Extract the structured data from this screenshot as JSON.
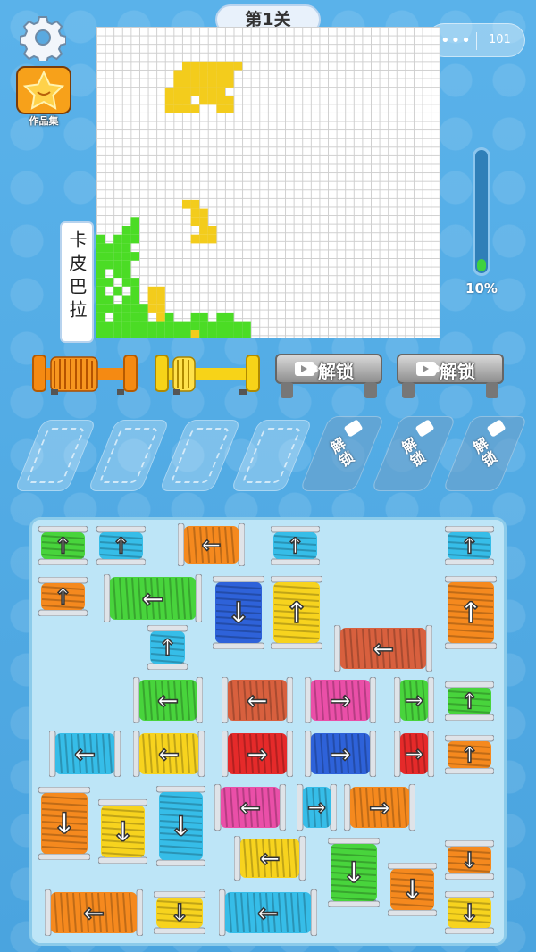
{
  "header": {
    "level_title": "第1关"
  },
  "works": {
    "label": "作品集"
  },
  "capsule": {
    "dots": "•••",
    "counter": "101"
  },
  "puzzle": {
    "name": "卡皮巴拉",
    "cols": 40,
    "rows": 36,
    "yellow_cells": [
      [
        10,
        4
      ],
      [
        11,
        4
      ],
      [
        12,
        4
      ],
      [
        13,
        4
      ],
      [
        14,
        4
      ],
      [
        15,
        4
      ],
      [
        16,
        4
      ],
      [
        9,
        5
      ],
      [
        10,
        5
      ],
      [
        11,
        5
      ],
      [
        12,
        5
      ],
      [
        13,
        5
      ],
      [
        14,
        5
      ],
      [
        15,
        5
      ],
      [
        9,
        6
      ],
      [
        10,
        6
      ],
      [
        11,
        6
      ],
      [
        12,
        6
      ],
      [
        13,
        6
      ],
      [
        14,
        6
      ],
      [
        15,
        6
      ],
      [
        8,
        7
      ],
      [
        9,
        7
      ],
      [
        10,
        7
      ],
      [
        11,
        7
      ],
      [
        12,
        7
      ],
      [
        13,
        7
      ],
      [
        14,
        7
      ],
      [
        8,
        8
      ],
      [
        9,
        8
      ],
      [
        10,
        8
      ],
      [
        12,
        8
      ],
      [
        13,
        8
      ],
      [
        14,
        8
      ],
      [
        15,
        8
      ],
      [
        8,
        9
      ],
      [
        9,
        9
      ],
      [
        10,
        9
      ],
      [
        11,
        9
      ],
      [
        14,
        9
      ],
      [
        15,
        9
      ],
      [
        10,
        20
      ],
      [
        11,
        20
      ],
      [
        11,
        21
      ],
      [
        12,
        21
      ],
      [
        11,
        22
      ],
      [
        12,
        22
      ],
      [
        12,
        23
      ],
      [
        13,
        23
      ],
      [
        11,
        24
      ],
      [
        12,
        24
      ],
      [
        13,
        24
      ],
      [
        6,
        30
      ],
      [
        7,
        30
      ],
      [
        6,
        31
      ],
      [
        7,
        31
      ],
      [
        6,
        32
      ],
      [
        7,
        32
      ],
      [
        7,
        33
      ],
      [
        11,
        35
      ]
    ],
    "green_cells": [
      [
        4,
        22
      ],
      [
        3,
        23
      ],
      [
        4,
        23
      ],
      [
        2,
        24
      ],
      [
        3,
        24
      ],
      [
        4,
        24
      ],
      [
        0,
        24
      ],
      [
        0,
        25
      ],
      [
        1,
        25
      ],
      [
        2,
        25
      ],
      [
        3,
        25
      ],
      [
        0,
        26
      ],
      [
        1,
        26
      ],
      [
        2,
        26
      ],
      [
        3,
        26
      ],
      [
        4,
        26
      ],
      [
        0,
        27
      ],
      [
        1,
        27
      ],
      [
        2,
        27
      ],
      [
        3,
        27
      ],
      [
        0,
        28
      ],
      [
        2,
        28
      ],
      [
        3,
        28
      ],
      [
        0,
        29
      ],
      [
        1,
        29
      ],
      [
        3,
        29
      ],
      [
        4,
        29
      ],
      [
        0,
        30
      ],
      [
        2,
        30
      ],
      [
        4,
        30
      ],
      [
        0,
        31
      ],
      [
        1,
        31
      ],
      [
        3,
        31
      ],
      [
        4,
        31
      ],
      [
        0,
        32
      ],
      [
        1,
        32
      ],
      [
        2,
        32
      ],
      [
        3,
        32
      ],
      [
        4,
        32
      ],
      [
        5,
        32
      ],
      [
        0,
        33
      ],
      [
        2,
        33
      ],
      [
        3,
        33
      ],
      [
        4,
        33
      ],
      [
        5,
        33
      ],
      [
        8,
        33
      ],
      [
        11,
        33
      ],
      [
        12,
        33
      ],
      [
        14,
        33
      ],
      [
        15,
        33
      ],
      [
        0,
        34
      ],
      [
        1,
        34
      ],
      [
        2,
        34
      ],
      [
        3,
        34
      ],
      [
        4,
        34
      ],
      [
        5,
        34
      ],
      [
        6,
        34
      ],
      [
        7,
        34
      ],
      [
        8,
        34
      ],
      [
        9,
        34
      ],
      [
        10,
        34
      ],
      [
        11,
        34
      ],
      [
        12,
        34
      ],
      [
        13,
        34
      ],
      [
        14,
        34
      ],
      [
        15,
        34
      ],
      [
        16,
        34
      ],
      [
        17,
        34
      ],
      [
        0,
        35
      ],
      [
        1,
        35
      ],
      [
        2,
        35
      ],
      [
        3,
        35
      ],
      [
        4,
        35
      ],
      [
        5,
        35
      ],
      [
        6,
        35
      ],
      [
        7,
        35
      ],
      [
        8,
        35
      ],
      [
        9,
        35
      ],
      [
        10,
        35
      ],
      [
        12,
        35
      ],
      [
        13,
        35
      ],
      [
        14,
        35
      ],
      [
        15,
        35
      ],
      [
        16,
        35
      ],
      [
        17,
        35
      ]
    ]
  },
  "progress": {
    "value": 0.1,
    "label": "10%"
  },
  "reels": [
    {
      "color": "#f58a12"
    },
    {
      "color": "#f7d318"
    }
  ],
  "unlock_bars": [
    {
      "label": "解锁"
    },
    {
      "label": "解锁"
    }
  ],
  "slots_locked": [
    {
      "label": "解\n锁"
    },
    {
      "label": "解\n锁"
    },
    {
      "label": "解\n锁"
    }
  ],
  "palette": {
    "green": "#48d43c",
    "cyan": "#36bde8",
    "orange": "#f5891e",
    "blue": "#2e62d9",
    "yellow": "#f7d31e",
    "rust": "#d8603e",
    "pink": "#ea4fa8",
    "red": "#e52a2a"
  },
  "spools": [
    {
      "c": "green",
      "d": "up"
    },
    {
      "c": "cyan",
      "d": "up"
    },
    {
      "c": "orange",
      "d": "left"
    },
    {
      "c": "cyan",
      "d": "up"
    },
    {
      "c": "cyan",
      "d": "up"
    },
    {
      "c": "orange",
      "d": "up"
    },
    {
      "c": "green",
      "d": "left"
    },
    {
      "c": "blue",
      "d": "down"
    },
    {
      "c": "yellow",
      "d": "up"
    },
    {
      "c": "orange",
      "d": "up"
    },
    {
      "c": "cyan",
      "d": "up"
    },
    {
      "c": "rust",
      "d": "left"
    },
    {
      "c": "green",
      "d": "left"
    },
    {
      "c": "rust",
      "d": "left"
    },
    {
      "c": "pink",
      "d": "right"
    },
    {
      "c": "green",
      "d": "right"
    },
    {
      "c": "green",
      "d": "up"
    },
    {
      "c": "cyan",
      "d": "left"
    },
    {
      "c": "yellow",
      "d": "left"
    },
    {
      "c": "red",
      "d": "right"
    },
    {
      "c": "blue",
      "d": "right"
    },
    {
      "c": "red",
      "d": "right"
    },
    {
      "c": "orange",
      "d": "up"
    },
    {
      "c": "orange",
      "d": "down"
    },
    {
      "c": "yellow",
      "d": "down"
    },
    {
      "c": "cyan",
      "d": "down"
    },
    {
      "c": "pink",
      "d": "left"
    },
    {
      "c": "cyan",
      "d": "right"
    },
    {
      "c": "orange",
      "d": "right"
    },
    {
      "c": "yellow",
      "d": "left"
    },
    {
      "c": "green",
      "d": "down"
    },
    {
      "c": "orange",
      "d": "down"
    },
    {
      "c": "orange",
      "d": "down"
    },
    {
      "c": "orange",
      "d": "left"
    },
    {
      "c": "yellow",
      "d": "down"
    },
    {
      "c": "cyan",
      "d": "left"
    },
    {
      "c": "yellow",
      "d": "down"
    }
  ]
}
